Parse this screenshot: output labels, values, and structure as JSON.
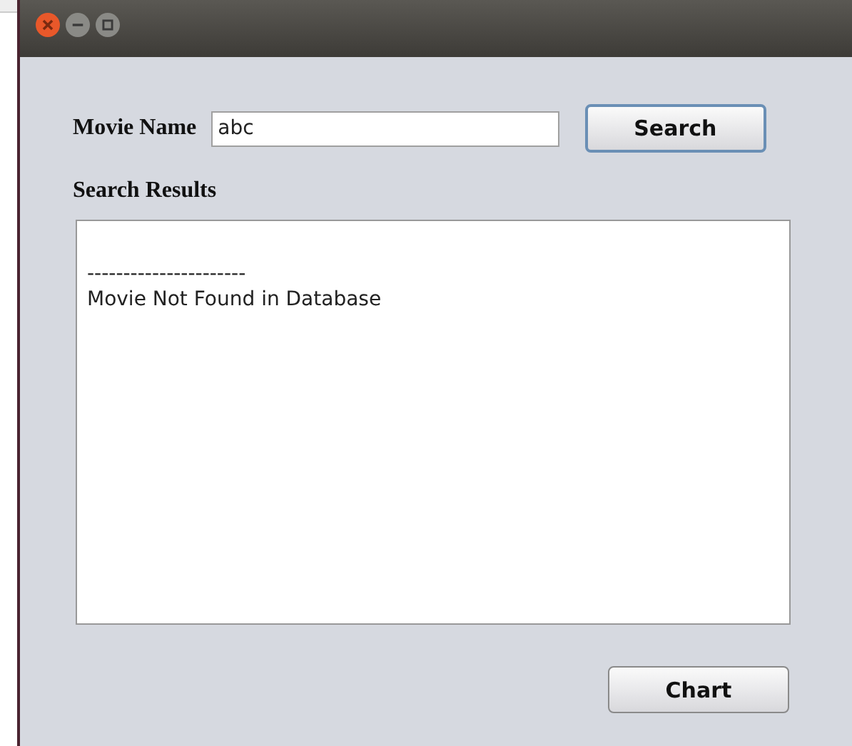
{
  "window": {
    "buttons": [
      {
        "kind": "close"
      },
      {
        "kind": "minimize"
      },
      {
        "kind": "maximize"
      }
    ]
  },
  "search": {
    "label": "Movie Name",
    "value": "abc",
    "button": "Search"
  },
  "results": {
    "label": "Search Results",
    "lines": [
      "----------------------",
      "Movie Not Found in Database"
    ]
  },
  "buttons": [
    "Chart"
  ]
}
